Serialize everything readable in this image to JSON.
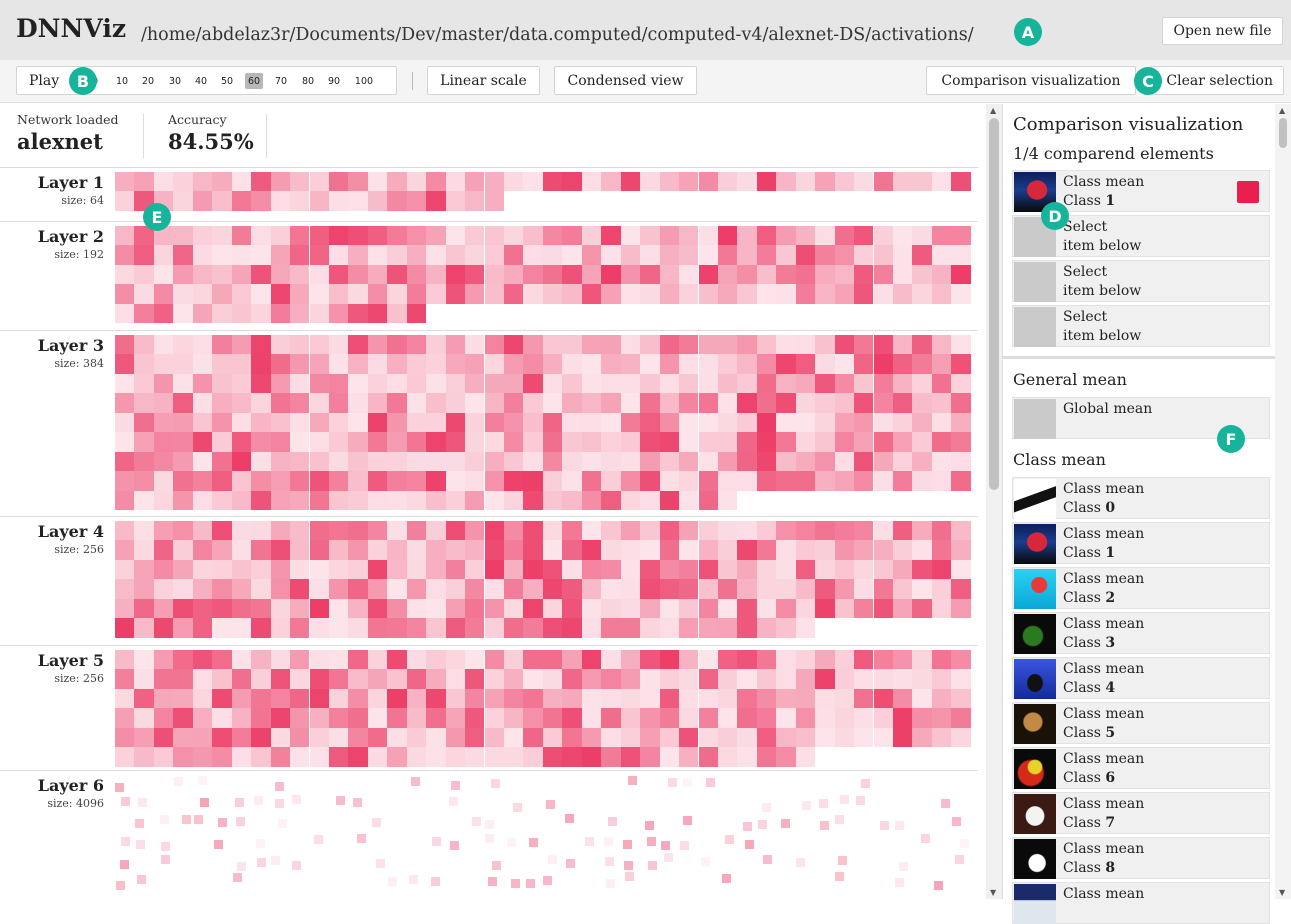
{
  "header": {
    "logo": "DNNViz",
    "path": "/home/abdelaz3r/Documents/Dev/master/data.computed/computed-v4/alexnet-DS/activations/",
    "open_button": "Open new file"
  },
  "toolbar": {
    "play": "Play",
    "epochs": [
      "0",
      "10",
      "20",
      "30",
      "40",
      "50",
      "60",
      "70",
      "80",
      "90",
      "100"
    ],
    "selected_epoch": "60",
    "linear_scale": "Linear scale",
    "condensed_view": "Condensed view",
    "comparison_button": "Comparison visualization",
    "clear_button": "Clear selection"
  },
  "markers": {
    "a": "A",
    "b": "B",
    "c": "C",
    "d": "D",
    "e": "E",
    "f": "F"
  },
  "stats": {
    "network_label": "Network loaded",
    "network_value": "alexnet",
    "accuracy_label": "Accuracy",
    "accuracy_value": "84.55%"
  },
  "layers": [
    {
      "name": "Layer 1",
      "size": "size: 64",
      "count": 64
    },
    {
      "name": "Layer 2",
      "size": "size: 192",
      "count": 192
    },
    {
      "name": "Layer 3",
      "size": "size: 384",
      "count": 384
    },
    {
      "name": "Layer 4",
      "size": "size: 256",
      "count": 256
    },
    {
      "name": "Layer 5",
      "size": "size: 256",
      "count": 256
    },
    {
      "name": "Layer 6",
      "size": "size: 4096",
      "count": 4096
    }
  ],
  "panel": {
    "title": "Comparison visualization",
    "count": "1/4 comparend elements",
    "comparands": [
      {
        "line1": "Class mean",
        "line2_prefix": "Class ",
        "line2_bold": "1",
        "swatch": "#e91e4f",
        "thumb": "car"
      },
      {
        "line1": "Select",
        "line2_prefix": "item below",
        "line2_bold": ""
      },
      {
        "line1": "Select",
        "line2_prefix": "item below",
        "line2_bold": ""
      },
      {
        "line1": "Select",
        "line2_prefix": "item below",
        "line2_bold": ""
      }
    ],
    "general_title": "General mean",
    "global_mean": "Global mean",
    "class_title": "Class mean",
    "classes": [
      {
        "line1": "Class mean",
        "prefix": "Class ",
        "num": "0",
        "thumb": "plane"
      },
      {
        "line1": "Class mean",
        "prefix": "Class ",
        "num": "1",
        "thumb": "car"
      },
      {
        "line1": "Class mean",
        "prefix": "Class ",
        "num": "2",
        "thumb": "bird"
      },
      {
        "line1": "Class mean",
        "prefix": "Class ",
        "num": "3",
        "thumb": "cat"
      },
      {
        "line1": "Class mean",
        "prefix": "Class ",
        "num": "4",
        "thumb": "deer"
      },
      {
        "line1": "Class mean",
        "prefix": "Class ",
        "num": "5",
        "thumb": "dog"
      },
      {
        "line1": "Class mean",
        "prefix": "Class ",
        "num": "6",
        "thumb": "frog"
      },
      {
        "line1": "Class mean",
        "prefix": "Class ",
        "num": "7",
        "thumb": "horse"
      },
      {
        "line1": "Class mean",
        "prefix": "Class ",
        "num": "8",
        "thumb": "ship"
      },
      {
        "line1": "Class mean",
        "prefix": "",
        "num": "",
        "thumb": "truck"
      }
    ]
  },
  "colors": {
    "accent": "#16b49a",
    "swatch": "#e91e4f",
    "heat": "#e91e4f"
  }
}
